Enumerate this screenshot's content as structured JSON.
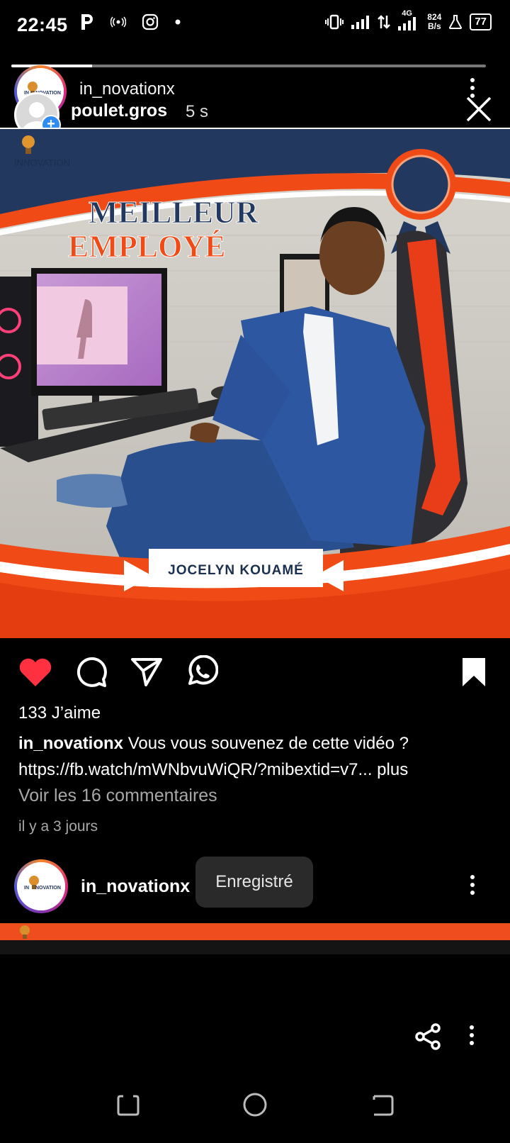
{
  "status_bar": {
    "time": "22:45",
    "network_type": "4G",
    "net_speed_value": "824",
    "net_speed_unit": "B/s",
    "battery": "77"
  },
  "story": {
    "account": "in_novationx",
    "viewer": "poulet.gros",
    "elapsed": "5 s",
    "progress": 0.17
  },
  "post": {
    "image": {
      "brand_text": "INNOVATION",
      "headline_line1": "MEILLEUR",
      "headline_line2": "EMPLOYÉ",
      "name_banner": "JOCELYN  KOUAMÉ",
      "colors": {
        "navy": "#22385f",
        "orange": "#f04b16"
      }
    },
    "likes": "133 J’aime",
    "caption_user": "in_novationx",
    "caption_text": "Vous vous souvenez de cette vidéo ?",
    "caption_link": "https://fb.watch/mWNbvuWiQR/?mibextid=v7...",
    "more": "plus",
    "comments_link": "Voir les 16 commentaires",
    "date": "il y a 3 jours",
    "liked": true,
    "saved": true
  },
  "next_post": {
    "account": "in_novationx"
  },
  "toast": "Enregistré",
  "icons": {
    "like": "heart-icon",
    "comment": "comment-icon",
    "share": "send-icon",
    "whatsapp": "whatsapp-icon",
    "save": "bookmark-icon"
  }
}
